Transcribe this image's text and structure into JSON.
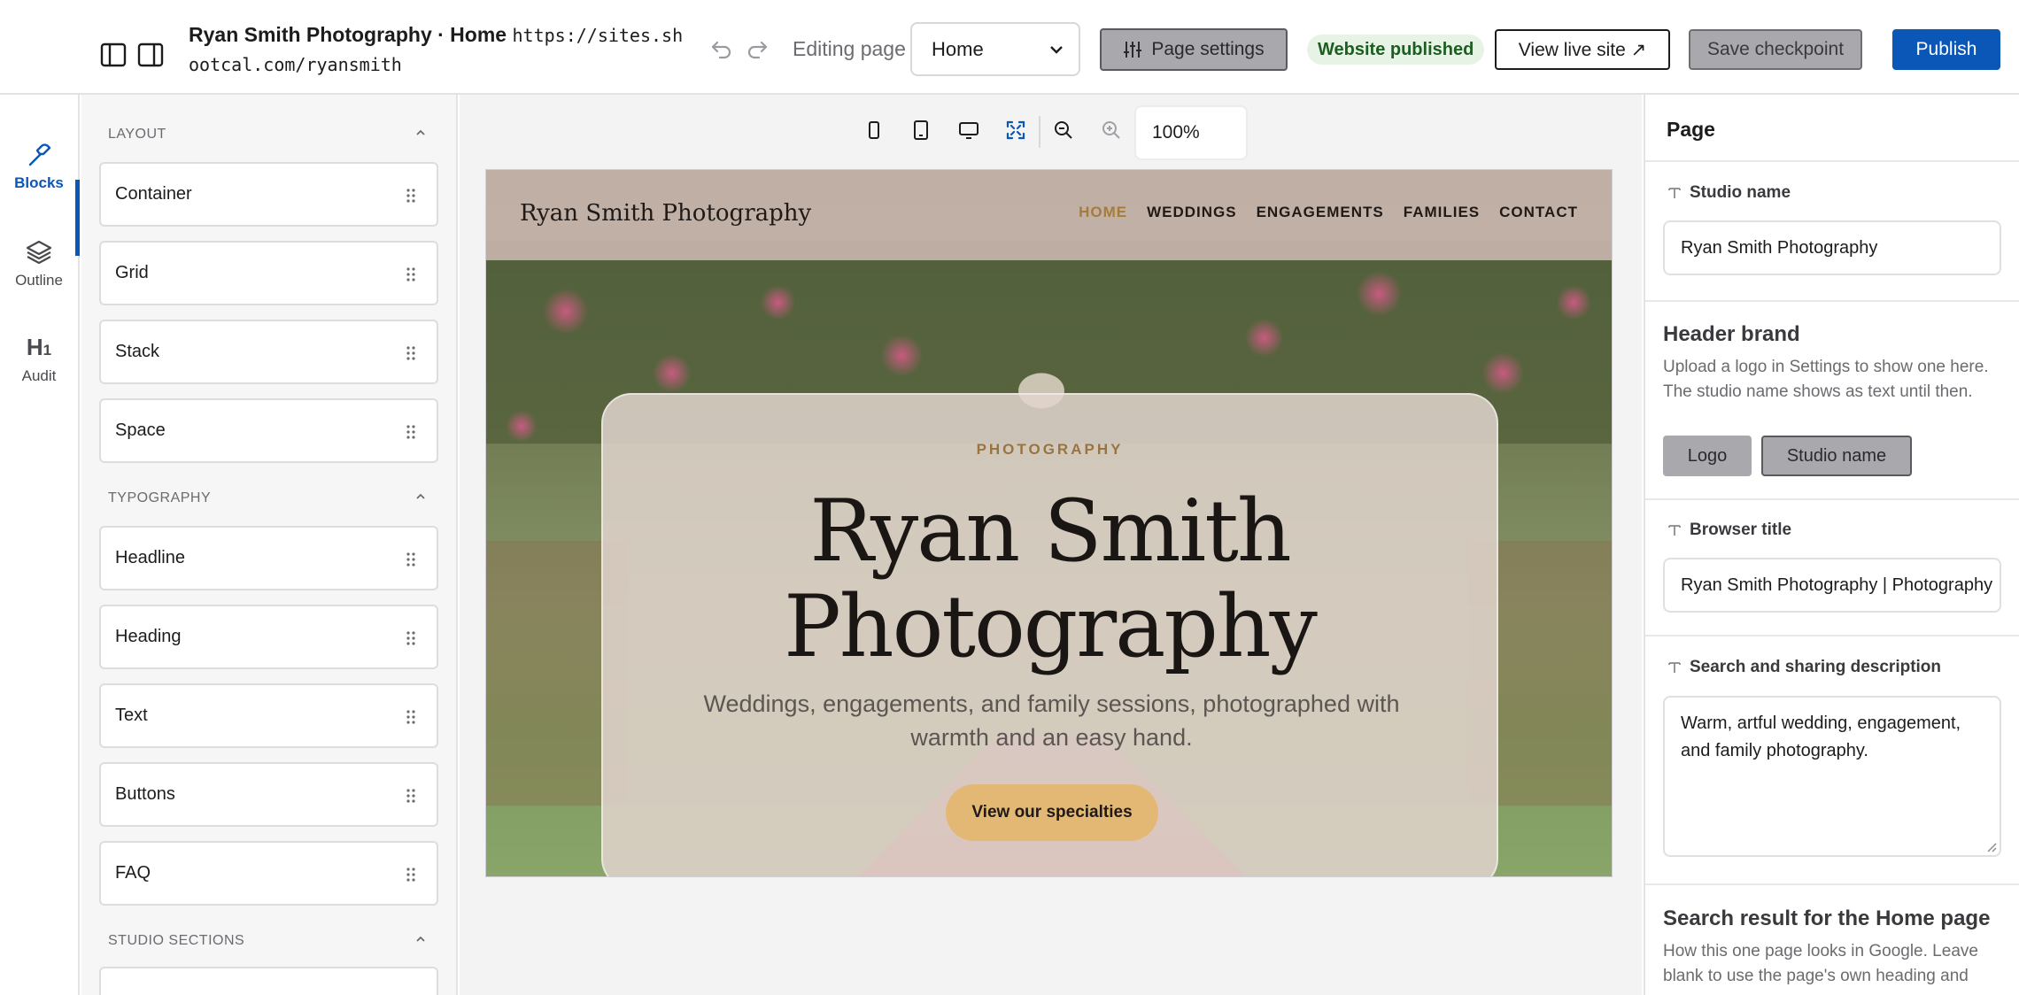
{
  "topbar": {
    "site_name": "Ryan Smith Photography · Home",
    "site_url": "https://sites.shootcal.com/ryansmith",
    "editing_label": "Editing page",
    "page_selected": "Home",
    "page_settings_label": "Page settings",
    "published_badge": "Website published",
    "view_live_label": "View live site ↗",
    "save_checkpoint_label": "Save checkpoint",
    "publish_label": "Publish",
    "accent_color": "#0b57b8"
  },
  "rail": {
    "items": [
      {
        "label": "Blocks",
        "icon": "hammer-icon",
        "active": true
      },
      {
        "label": "Outline",
        "icon": "layers-icon",
        "active": false
      },
      {
        "label": "Audit",
        "icon": "h1-icon",
        "active": false
      }
    ]
  },
  "blocks": {
    "layout_title": "LAYOUT",
    "layout_items": [
      "Container",
      "Grid",
      "Stack",
      "Space"
    ],
    "typography_title": "TYPOGRAPHY",
    "typography_items": [
      "Headline",
      "Heading",
      "Text",
      "Buttons",
      "FAQ"
    ],
    "studio_title": "STUDIO SECTIONS"
  },
  "canvas": {
    "zoom": "100%",
    "site": {
      "brand": "Ryan Smith Photography",
      "nav": [
        "HOME",
        "WEDDINGS",
        "ENGAGEMENTS",
        "FAMILIES",
        "CONTACT"
      ],
      "eyebrow": "PHOTOGRAPHY",
      "title_line1": "Ryan Smith",
      "title_line2": "Photography",
      "subtitle": "Weddings, engagements, and family sessions, photographed with warmth and an easy hand.",
      "cta": "View our specialties"
    }
  },
  "props": {
    "title": "Page",
    "studio_name_label": "Studio name",
    "studio_name_value": "Ryan Smith Photography",
    "header_brand_title": "Header brand",
    "header_brand_help": "Upload a logo in Settings to show one here. The studio name shows as text until then.",
    "logo_option": "Logo",
    "studio_name_option": "Studio name",
    "browser_title_label": "Browser title",
    "browser_title_value": "Ryan Smith Photography | Photography",
    "description_label": "Search and sharing description",
    "description_value": "Warm, artful wedding, engagement, and family photography.",
    "search_result_title": "Search result for the Home page",
    "search_result_help": "How this one page looks in Google. Leave blank to use the page's own heading and"
  }
}
